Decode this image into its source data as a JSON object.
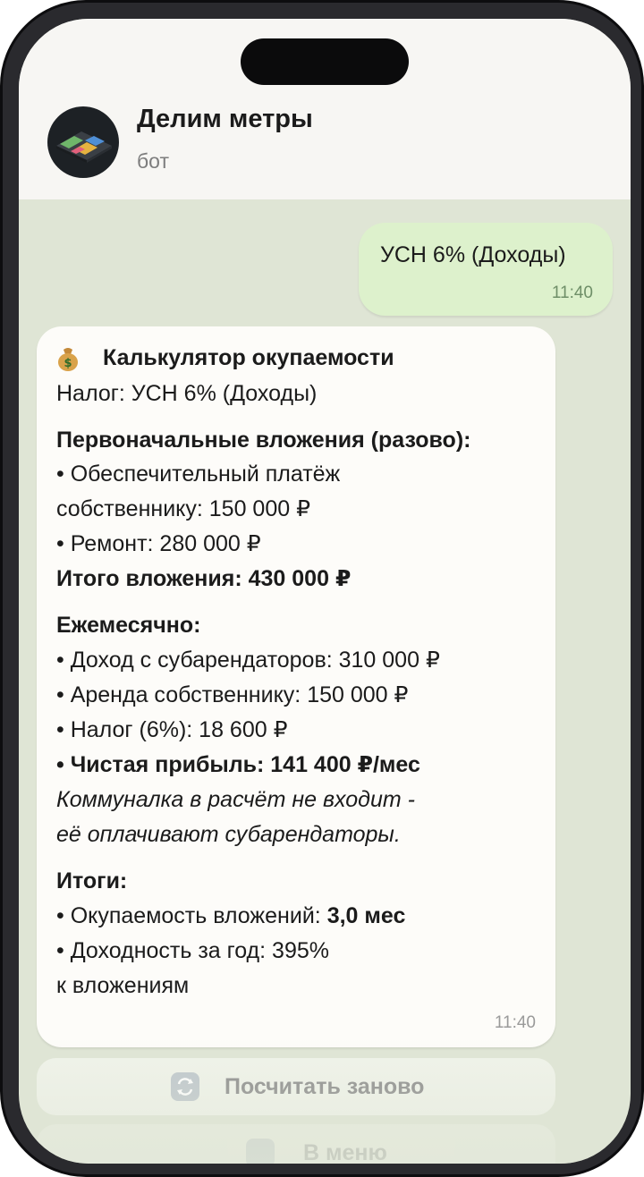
{
  "header": {
    "title": "Делим метры",
    "subtitle": "бот"
  },
  "outgoing_message": {
    "text": "УСН 6% (Доходы)",
    "time": "11:40"
  },
  "bot_message": {
    "emoji_icon": "money-bag-icon",
    "title": "Калькулятор окупаемости",
    "tax_line": "Налог: УСН 6% (Доходы)",
    "initial_header": "Первоначальные вложения (разово):",
    "deposit_line_1": "• Обеспечительный платёж",
    "deposit_line_2": "собственнику: 150 000 ₽",
    "repair_line": "• Ремонт: 280 000 ₽",
    "total_label": "Итого вложения: ",
    "total_value": "430 000 ₽",
    "monthly_header": "Ежемесячно:",
    "income_line": "• Доход с субарендаторов: 310 000 ₽",
    "rent_line": "• Аренда собственнику: 150 000 ₽",
    "tax_amount_line": "• Налог (6%): 18 600 ₽",
    "profit_line": "• Чистая прибыль: 141 400 ₽/мес",
    "note_line_1": "Коммуналка в расчёт не входит -",
    "note_line_2": "её оплачивают субарендаторы.",
    "results_header": "Итоги:",
    "payback_label": "• Окупаемость вложений: ",
    "payback_value": "3,0 мес",
    "yield_line_1": "• Доходность за год: 395%",
    "yield_line_2": "к вложениям",
    "time": "11:40"
  },
  "keyboard": {
    "recalc_label": "Посчитать заново",
    "recalc_icon": "repeat-icon",
    "menu_label": "В меню",
    "menu_icon": "menu-icon"
  },
  "colors": {
    "chat_background": "#dfe5d5",
    "outgoing_bubble": "#ddf1cc",
    "incoming_bubble": "#fdfcf9"
  }
}
